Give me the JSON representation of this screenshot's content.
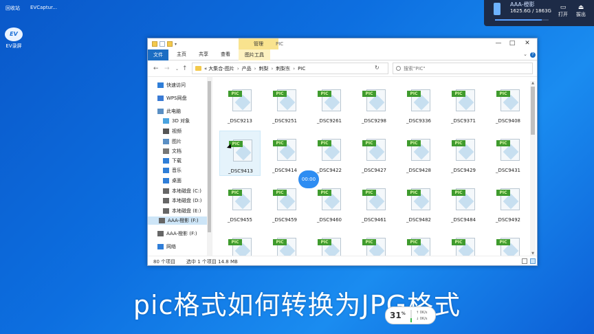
{
  "desktop": {
    "top_labels": [
      "回收站",
      "EVCaptur..."
    ],
    "ev_icon_label": "EV录屏",
    "ev_logo_text": "EV"
  },
  "drive_popup": {
    "name": "AAA-橙影",
    "capacity": "1625.6G / 1863G",
    "usage_fraction": 0.87,
    "open_label": "打开",
    "eject_label": "拔出"
  },
  "window": {
    "title": "PIC",
    "manage_tab": "管理",
    "ribbon_tabs": [
      "文件",
      "主页",
      "共享",
      "查看"
    ],
    "picture_tools_tab": "图片工具",
    "help": "?",
    "address_path": [
      "«",
      "大集合-图片",
      "产品",
      "刺梨",
      "刺梨东",
      "PIC"
    ],
    "search_placeholder": "搜索\"PIC\"",
    "controls": [
      "—",
      "□",
      "✕"
    ]
  },
  "sidebar": {
    "items": [
      {
        "label": "快速访问",
        "icon": "star-icon",
        "color": "#2f7ed8"
      },
      {
        "label": "WPS网盘",
        "icon": "cloud-icon",
        "color": "#3a7bd5"
      },
      {
        "label": "此电脑",
        "icon": "computer-icon",
        "color": "#5a8fc4"
      },
      {
        "label": "3D 对象",
        "icon": "cube-icon",
        "color": "#4aa3df"
      },
      {
        "label": "视频",
        "icon": "video-icon",
        "color": "#555"
      },
      {
        "label": "图片",
        "icon": "picture-icon",
        "color": "#5a8fc4"
      },
      {
        "label": "文档",
        "icon": "document-icon",
        "color": "#777"
      },
      {
        "label": "下载",
        "icon": "download-icon",
        "color": "#2f7ed8"
      },
      {
        "label": "音乐",
        "icon": "music-icon",
        "color": "#2f7ed8"
      },
      {
        "label": "桌面",
        "icon": "desktop-icon",
        "color": "#2f7ed8"
      },
      {
        "label": "本地磁盘 (C:)",
        "icon": "drive-icon",
        "color": "#666"
      },
      {
        "label": "本地磁盘 (D:)",
        "icon": "drive-icon",
        "color": "#666"
      },
      {
        "label": "本地磁盘 (E:)",
        "icon": "drive-icon",
        "color": "#666"
      },
      {
        "label": "AAA-橙影 (F:)",
        "icon": "drive-icon",
        "color": "#666"
      },
      {
        "label": "AAA-橙影 (F:)",
        "icon": "drive-icon",
        "color": "#666"
      },
      {
        "label": "网络",
        "icon": "network-icon",
        "color": "#2f7ed8"
      }
    ]
  },
  "files": [
    "_DSC9213",
    "_DSC9251",
    "_DSC9261",
    "_DSC9298",
    "_DSC9336",
    "_DSC9371",
    "_DSC9408",
    "_DSC9413",
    "_DSC9414",
    "_DSC9422",
    "_DSC9427",
    "_DSC9428",
    "_DSC9429",
    "_DSC9431",
    "_DSC9455",
    "_DSC9459",
    "_DSC9460",
    "_DSC9461",
    "_DSC9482",
    "_DSC9484",
    "_DSC9492",
    "",
    "",
    "",
    "",
    "",
    "",
    ""
  ],
  "file_badge": "PIC",
  "status": {
    "count": "80 个项目",
    "selection": "选中 1 个项目  14.8 MB"
  },
  "overlay": {
    "timer": "00:00",
    "caption": "pic格式如何转换为JPG格式",
    "net_percent": "31",
    "net_percent_unit": "%",
    "net_up": "0K/s",
    "net_down": "0K/s",
    "net_level": 0.31
  }
}
